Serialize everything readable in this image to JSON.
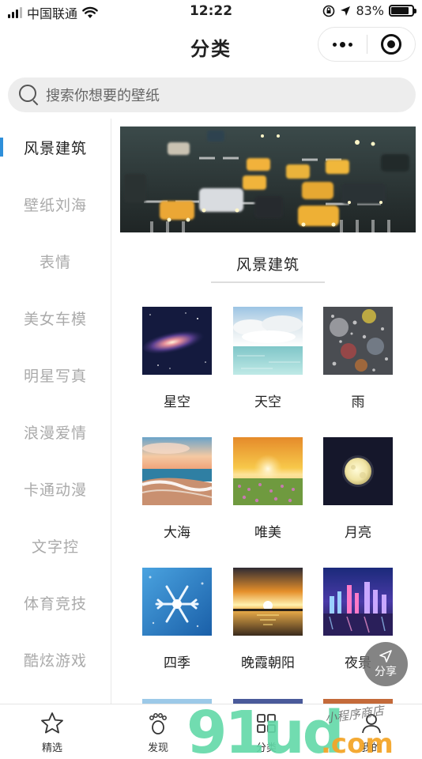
{
  "status_bar": {
    "carrier": "中国联通",
    "time": "12:22",
    "battery_text": "83%",
    "battery_level": 0.83
  },
  "nav": {
    "title": "分类",
    "more_icon": "ellipsis-icon",
    "close_icon": "target-icon"
  },
  "search": {
    "placeholder": "搜索你想要的壁纸",
    "icon": "search-icon"
  },
  "sidebar": {
    "accent_color": "#2e8fda",
    "items": [
      {
        "label": "风景建筑",
        "active": true
      },
      {
        "label": "壁纸刘海",
        "active": false
      },
      {
        "label": "表情",
        "active": false
      },
      {
        "label": "美女车模",
        "active": false
      },
      {
        "label": "明星写真",
        "active": false
      },
      {
        "label": "浪漫爱情",
        "active": false
      },
      {
        "label": "卡通动漫",
        "active": false
      },
      {
        "label": "文字控",
        "active": false
      },
      {
        "label": "体育竞技",
        "active": false
      },
      {
        "label": "酷炫游戏",
        "active": false
      }
    ]
  },
  "content": {
    "section_title": "风景建筑",
    "grid": [
      {
        "label": "星空"
      },
      {
        "label": "天空"
      },
      {
        "label": "雨"
      },
      {
        "label": "大海"
      },
      {
        "label": "唯美"
      },
      {
        "label": "月亮"
      },
      {
        "label": "四季"
      },
      {
        "label": "晚霞朝阳"
      },
      {
        "label": "夜景"
      }
    ]
  },
  "share": {
    "label": "分享",
    "icon": "share-arrow-icon"
  },
  "tabbar": {
    "items": [
      {
        "label": "精选",
        "icon": "star-icon"
      },
      {
        "label": "发现",
        "icon": "footprint-icon"
      },
      {
        "label": "分类",
        "icon": "grid-icon"
      },
      {
        "label": "我的",
        "icon": "user-icon"
      }
    ]
  },
  "watermark": {
    "brand": "91ud",
    "suffix": ".com",
    "handwriting": "小程序商店"
  }
}
